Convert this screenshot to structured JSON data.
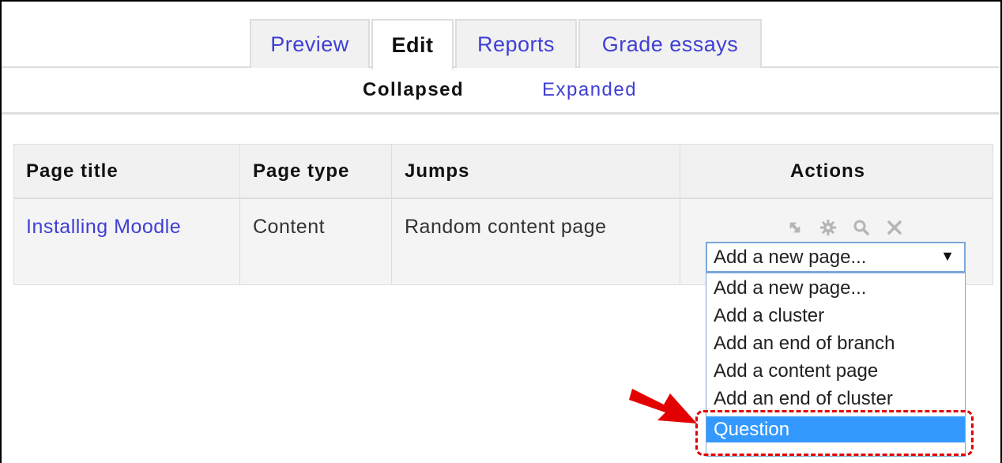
{
  "tabs": [
    {
      "label": "Preview"
    },
    {
      "label": "Edit"
    },
    {
      "label": "Reports"
    },
    {
      "label": "Grade essays"
    }
  ],
  "subtabs": [
    {
      "label": "Collapsed"
    },
    {
      "label": "Expanded"
    }
  ],
  "table": {
    "headers": [
      "Page title",
      "Page type",
      "Jumps",
      "Actions"
    ],
    "rows": [
      {
        "page_title": "Installing Moodle",
        "page_type": "Content",
        "jumps": "Random content page"
      }
    ]
  },
  "actions": {
    "icons": [
      "move-icon",
      "gear-icon",
      "preview-magnifier-icon",
      "delete-icon"
    ],
    "select_value": "Add a new page...",
    "options": [
      "Add a new page...",
      "Add a cluster",
      "Add an end of branch",
      "Add a content page",
      "Add an end of cluster",
      "Question"
    ],
    "selected_option": "Question"
  },
  "colors": {
    "link": "#3f3fd5",
    "highlight": "#3399ff",
    "annotation": "#e30000"
  }
}
